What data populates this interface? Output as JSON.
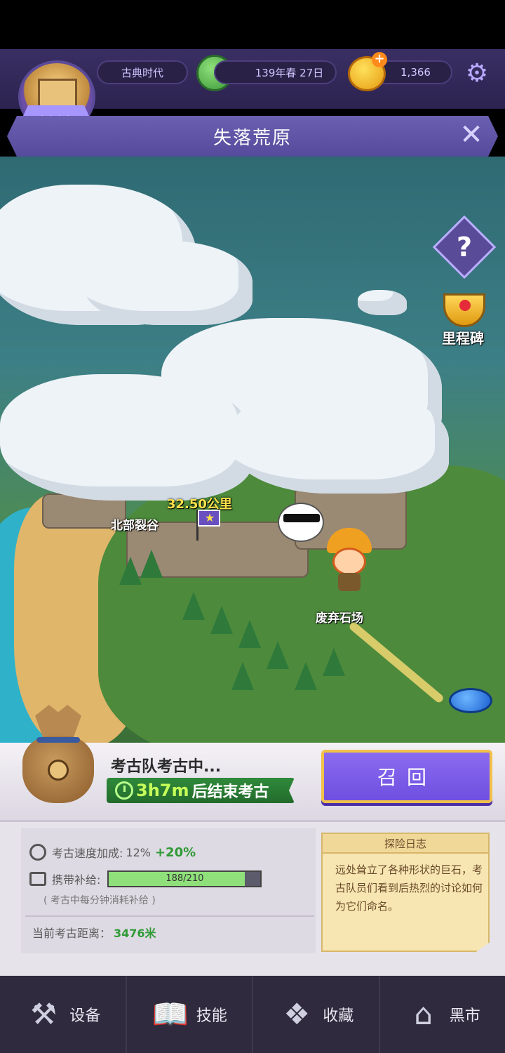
{
  "header": {
    "era_label": "古典时代",
    "date_label": "139年春 27日",
    "coins": "1,366"
  },
  "title": "失落荒原",
  "map": {
    "milestone_label": "里程碑",
    "distance_label": "32.50公里",
    "north_label": "北部裂谷",
    "quarry_label": "废弃石场"
  },
  "dig": {
    "status": "考古队考古中...",
    "time": "3h7m",
    "time_suffix": "后结束考古",
    "recall_button": "召回"
  },
  "stats": {
    "speed_label": "考古速度加成:",
    "speed_value": "12%",
    "speed_bonus": "+20%",
    "supply_label": "携带补给:",
    "supply_text": "188/210",
    "supply_ratio": 0.895,
    "supply_note": "( 考古中每分钟消耗补给 )",
    "distance_label": "当前考古距离：",
    "distance_value": "3476米"
  },
  "log": {
    "title": "探险日志",
    "text": "远处耸立了各种形状的巨石，考古队员们看到后热烈的讨论如何为它们命名。"
  },
  "nav": {
    "items": [
      {
        "label": "设备",
        "icon": "anvil-icon"
      },
      {
        "label": "技能",
        "icon": "book-icon"
      },
      {
        "label": "收藏",
        "icon": "collection-icon"
      },
      {
        "label": "黑市",
        "icon": "shop-icon"
      }
    ]
  }
}
